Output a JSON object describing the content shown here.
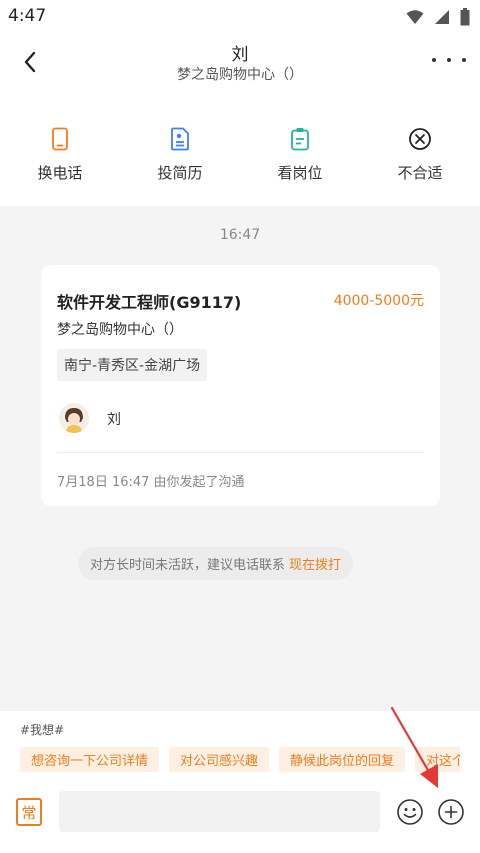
{
  "status_bar": {
    "time": "4:47"
  },
  "header": {
    "title": "刘",
    "subtitle": "梦之岛购物中心（）"
  },
  "actions": [
    {
      "label": "换电话",
      "icon": "phone-icon",
      "color": "#f07d1b"
    },
    {
      "label": "投简历",
      "icon": "resume-icon",
      "color": "#3b82f6"
    },
    {
      "label": "看岗位",
      "icon": "clipboard-icon",
      "color": "#1fb59a"
    },
    {
      "label": "不合适",
      "icon": "close-circle-icon",
      "color": "#222222"
    }
  ],
  "chat": {
    "timestamp": "16:47",
    "job_card": {
      "title": "软件开发工程师(G9117)",
      "salary": "4000-5000元",
      "company": "梦之岛购物中心（）",
      "location": "南宁-青秀区-金湖广场",
      "recruiter": "刘",
      "footer": "7月18日 16:47 由你发起了沟通"
    },
    "notice": {
      "text": "对方长时间未活跃，建议电话联系",
      "link": "现在拨打"
    }
  },
  "bottom": {
    "wish_tag": "#我想#",
    "chips": [
      "想咨询一下公司详情",
      "对公司感兴趣",
      "静候此岗位的回复",
      "对这个"
    ],
    "common_label": "常"
  },
  "colors": {
    "accent": "#f07d1b",
    "annotation": "#e53935"
  }
}
